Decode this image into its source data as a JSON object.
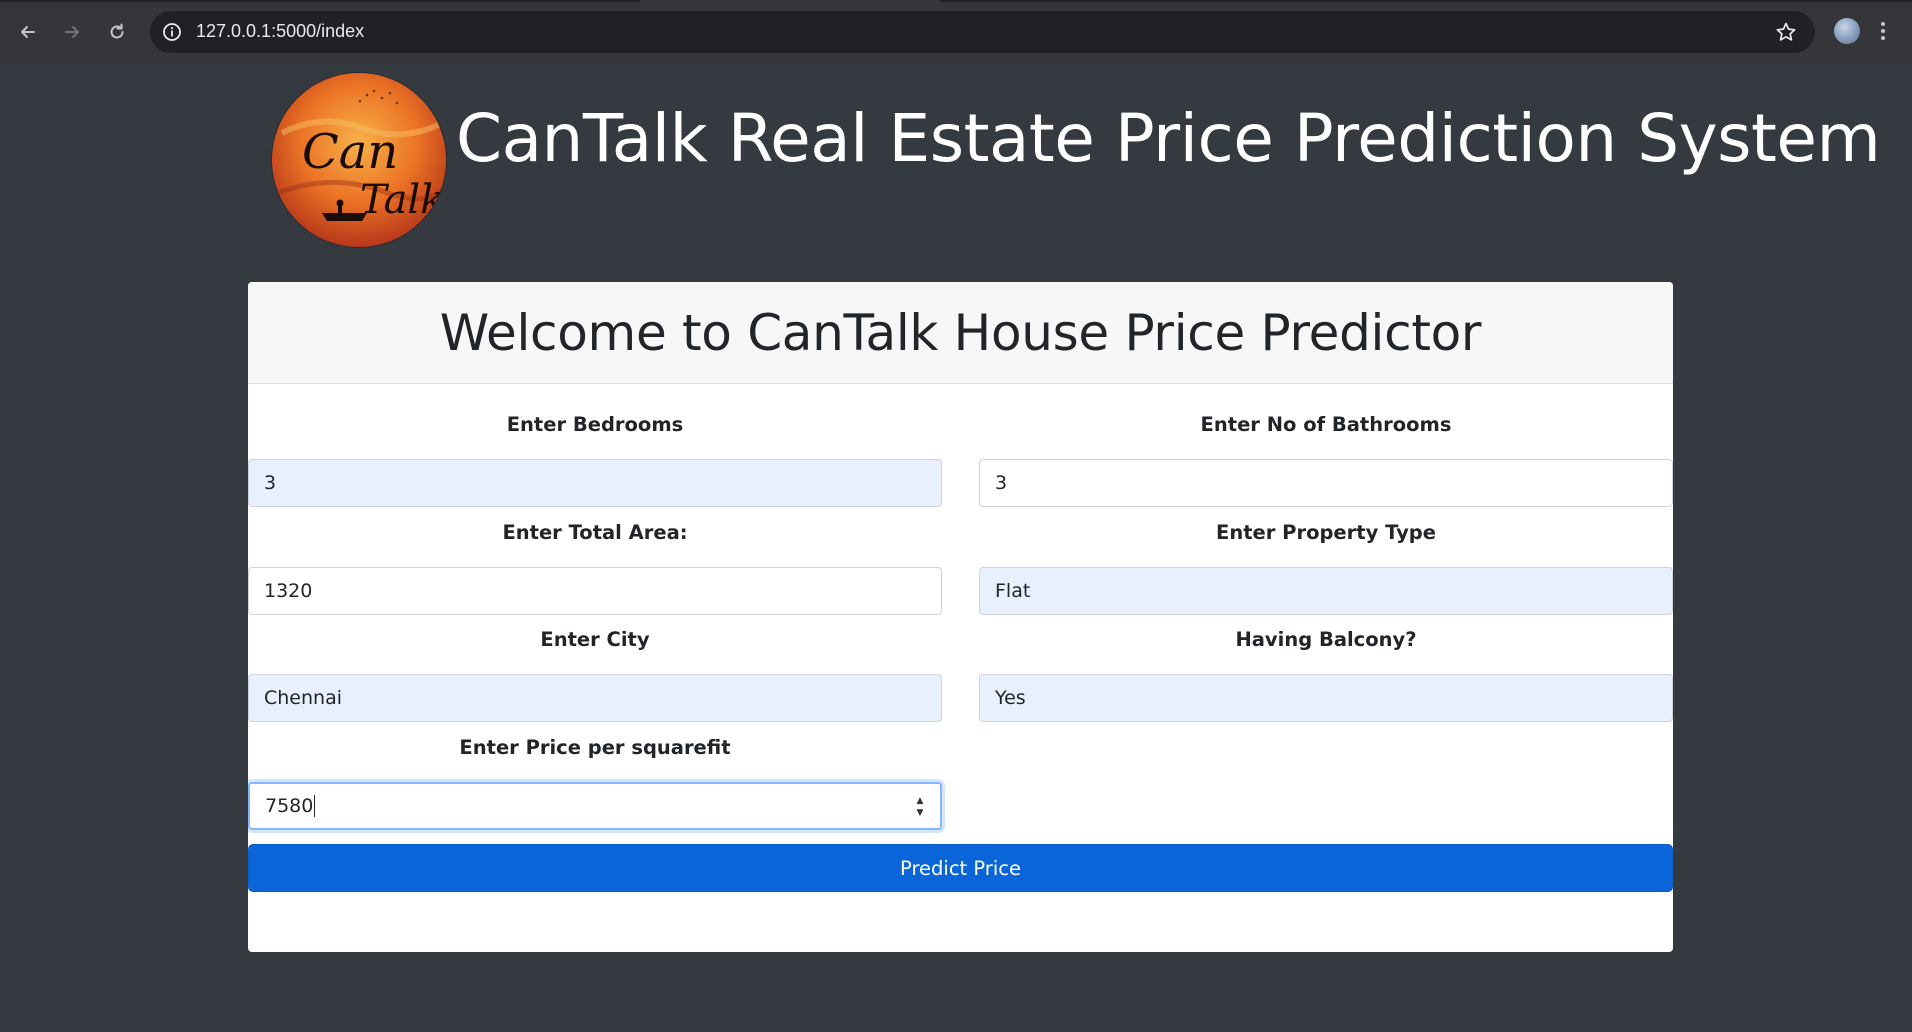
{
  "browser": {
    "url": "127.0.0.1:5000/index",
    "icons": [
      "back-arrow-icon",
      "forward-arrow-icon",
      "reload-icon",
      "info-icon",
      "star-icon",
      "kebab-menu-icon"
    ]
  },
  "header": {
    "logo_alt": "Can Talk",
    "title": "CanTalk Real Estate Price Prediction System"
  },
  "card": {
    "title": "Welcome to CanTalk House Price Predictor",
    "fields": {
      "bedrooms": {
        "label": "Enter Bedrooms",
        "value": "3"
      },
      "bathrooms": {
        "label": "Enter No of Bathrooms",
        "value": "3"
      },
      "area": {
        "label": "Enter Total Area:",
        "value": "1320"
      },
      "property_type": {
        "label": "Enter Property Type",
        "value": "Flat"
      },
      "city": {
        "label": "Enter City",
        "value": "Chennai"
      },
      "balcony": {
        "label": "Having Balcony?",
        "value": "Yes"
      },
      "price_sqft": {
        "label": "Enter Price per squarefit",
        "value": "7580"
      }
    },
    "submit_label": "Predict Price"
  },
  "colors": {
    "page_bg": "#343a40",
    "button_bg": "#0a66d8",
    "autofill_bg": "#e8f0fe"
  }
}
